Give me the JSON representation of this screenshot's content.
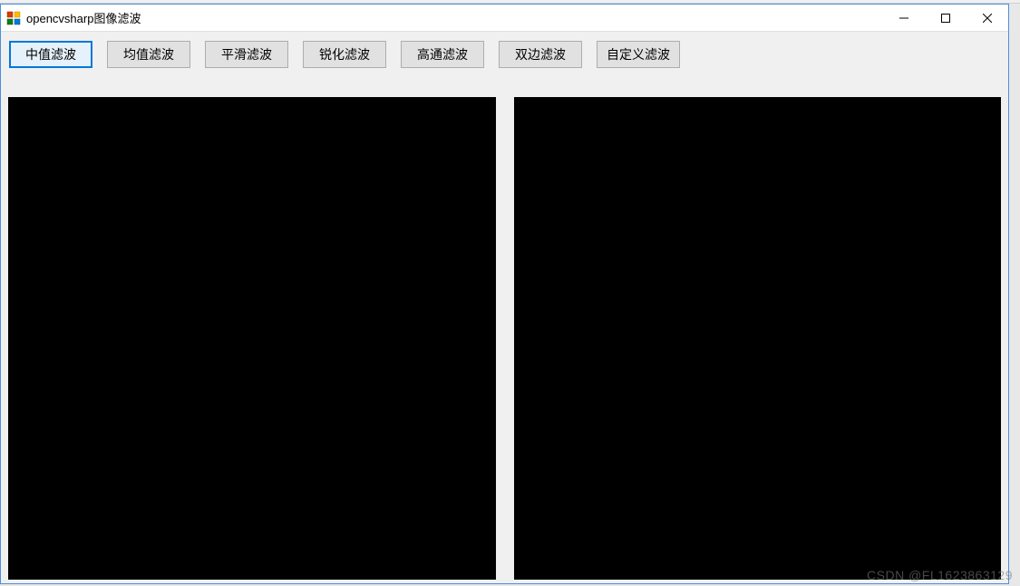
{
  "window": {
    "title": "opencvsharp图像滤波"
  },
  "toolbar": {
    "buttons": [
      {
        "label": "中值滤波",
        "selected": true
      },
      {
        "label": "均值滤波",
        "selected": false
      },
      {
        "label": "平滑滤波",
        "selected": false
      },
      {
        "label": "锐化滤波",
        "selected": false
      },
      {
        "label": "高通滤波",
        "selected": false
      },
      {
        "label": "双边滤波",
        "selected": false
      },
      {
        "label": "自定义滤波",
        "selected": false
      }
    ]
  },
  "watermark": "CSDN @FL1623863129"
}
